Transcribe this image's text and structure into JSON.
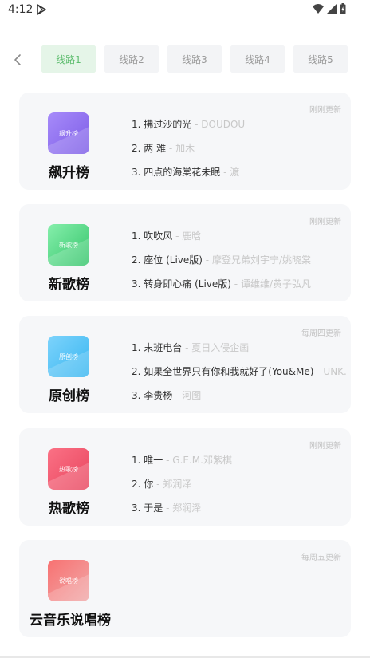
{
  "status_bar": {
    "time": "4:12",
    "icons": [
      "play-store-icon",
      "wifi-icon",
      "signal-icon",
      "battery-icon"
    ]
  },
  "nav": {
    "back_icon": "chevron-left-icon",
    "tabs": [
      "线路1",
      "线路2",
      "线路3",
      "线路4",
      "线路5"
    ],
    "active_tab": 0
  },
  "charts": [
    {
      "title": "飙升榜",
      "cover_text": "飙升榜",
      "cover_gradient": [
        "#a78bfa",
        "#7c5ce6"
      ],
      "update": "刚刚更新",
      "tracks": [
        {
          "n": "1.",
          "song": "拂过沙的光",
          "artist": "DOUDOU"
        },
        {
          "n": "2.",
          "song": "两 难",
          "artist": "加木"
        },
        {
          "n": "3.",
          "song": "四点的海棠花未眠",
          "artist": "渡"
        }
      ]
    },
    {
      "title": "新歌榜",
      "cover_text": "新歌榜",
      "cover_gradient": [
        "#86efac",
        "#34c46a"
      ],
      "update": "刚刚更新",
      "tracks": [
        {
          "n": "1.",
          "song": "吹吹风",
          "artist": "鹿晗"
        },
        {
          "n": "2.",
          "song": "座位 (Live版)",
          "artist": "摩登兄弟刘宇宁/姚晓棠"
        },
        {
          "n": "3.",
          "song": "转身即心痛 (Live版)",
          "artist": "谭维维/黄子弘凡"
        }
      ]
    },
    {
      "title": "原创榜",
      "cover_text": "原创榜",
      "cover_gradient": [
        "#7dd3fc",
        "#38b6f0"
      ],
      "update": "每周四更新",
      "tracks": [
        {
          "n": "1.",
          "song": "末班电台",
          "artist": "夏日入侵企画"
        },
        {
          "n": "2.",
          "song": "如果全世界只有你和我就好了(You&Me)",
          "artist": "UNK..."
        },
        {
          "n": "3.",
          "song": "李贵杨",
          "artist": "河图"
        }
      ]
    },
    {
      "title": "热歌榜",
      "cover_text": "热歌榜",
      "cover_gradient": [
        "#fb7185",
        "#e8455e"
      ],
      "update": "刚刚更新",
      "tracks": [
        {
          "n": "1.",
          "song": "唯一",
          "artist": "G.E.M.邓紫棋"
        },
        {
          "n": "2.",
          "song": "你",
          "artist": "郑润泽"
        },
        {
          "n": "3.",
          "song": "于是",
          "artist": "郑润泽"
        }
      ]
    },
    {
      "title": "云音乐说唱榜",
      "cover_text": "说唱榜",
      "cover_gradient": [
        "#f87171",
        "#f0a9a9"
      ],
      "update": "每周五更新",
      "tracks": []
    }
  ]
}
